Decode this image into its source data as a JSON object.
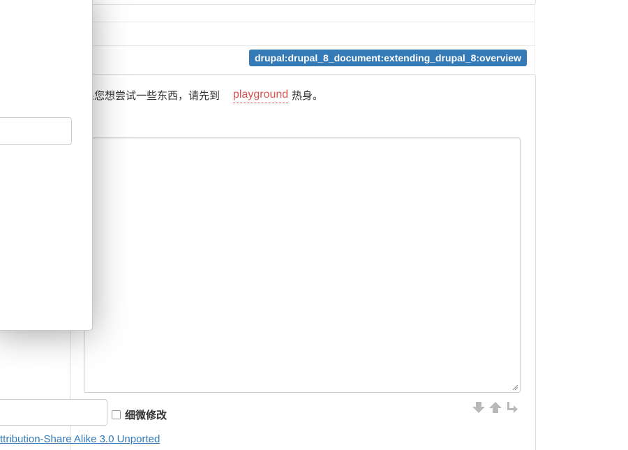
{
  "page_id": "drupal:drupal_8_document:extending_drupal_8:overview",
  "intro": {
    "text_before": "果您想尝试一些东西，请先到",
    "link_text": "playground",
    "text_after": "热身。"
  },
  "editor": {
    "value": ""
  },
  "summary_input": {
    "value": ""
  },
  "minor_edit": {
    "label": "细微修改",
    "checked": false
  },
  "license": {
    "text": "ttribution-Share Alike 3.0 Unported"
  },
  "dialog": {
    "input_value": ""
  },
  "icons": {
    "size_down": "arrow-down-icon",
    "size_up": "arrow-up-icon",
    "wrap": "wrap-icon",
    "resize": "resize-grip-icon"
  },
  "colors": {
    "badge_bg": "#337ab7",
    "link_red": "#d9534f",
    "license_link": "#337ab7"
  }
}
